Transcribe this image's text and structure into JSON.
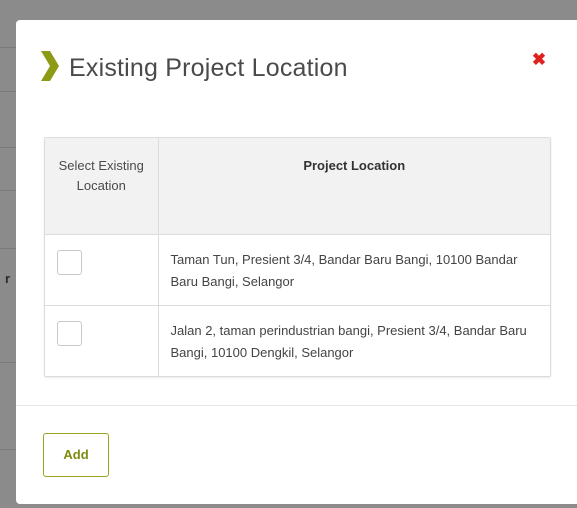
{
  "background_page": {
    "fragment_text": "r"
  },
  "modal": {
    "title": "Existing Project Location",
    "title_icon": "chevron-right-icon",
    "close_icon": "close-icon",
    "close_symbol": "✖",
    "table": {
      "headers": {
        "select": "Select Existing Location",
        "location": "Project Location"
      },
      "rows": [
        {
          "checked": false,
          "location": "Taman Tun, Presient 3/4, Bandar Baru Bangi, 10100 Bandar Baru Bangi, Selangor"
        },
        {
          "checked": false,
          "location": "Jalan 2, taman perindustrian bangi, Presient 3/4, Bandar Baru Bangi, 10100 Dengkil, Selangor"
        }
      ]
    },
    "add_button_label": "Add"
  },
  "colors": {
    "accent": "#8c9a14",
    "close": "#e0201d",
    "overlay": "#8b8b8b"
  }
}
